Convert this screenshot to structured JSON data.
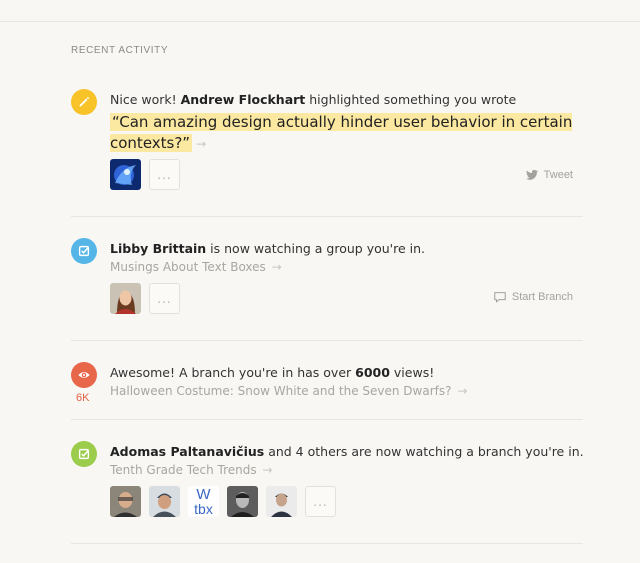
{
  "section_title": "RECENT ACTIVITY",
  "colors": {
    "pencil_badge": "#f7c329",
    "watch_badge": "#54b6e7",
    "views_badge": "#e8664a",
    "watch_badge_green": "#9ccc4b",
    "highlight": "#fbe8a1",
    "views_count": "#e45f40"
  },
  "items": [
    {
      "icon": "pencil-icon",
      "line_prefix": "Nice work! ",
      "actor": "Andrew Flockhart",
      "line_suffix": " highlighted something you wrote",
      "quote": "“Can amazing design actually hinder user behavior in certain contexts?”",
      "arrow": "→",
      "more": "...",
      "action": "Tweet"
    },
    {
      "icon": "watch-check-icon",
      "actor": "Libby Brittain",
      "line_suffix": " is now watching a group you're in.",
      "sub": "Musings About Text Boxes",
      "arrow": "→",
      "more": "...",
      "action": "Start Branch"
    },
    {
      "icon": "eye-icon",
      "count": "6K",
      "line_prefix": "Awesome! A branch you're in has over ",
      "bold": "6000",
      "line_suffix": " views!",
      "sub": "Halloween Costume: Snow White and the Seven Dwarfs?",
      "arrow": "→"
    },
    {
      "icon": "watch-check-icon",
      "actor": "Adomas Paltanavičius",
      "line_suffix": " and 4 others are now watching a branch you're in.",
      "sub": "Tenth Grade Tech Trends",
      "arrow": "→",
      "wtbx_top": "W",
      "wtbx_bottom": "tbx",
      "more": "..."
    }
  ]
}
